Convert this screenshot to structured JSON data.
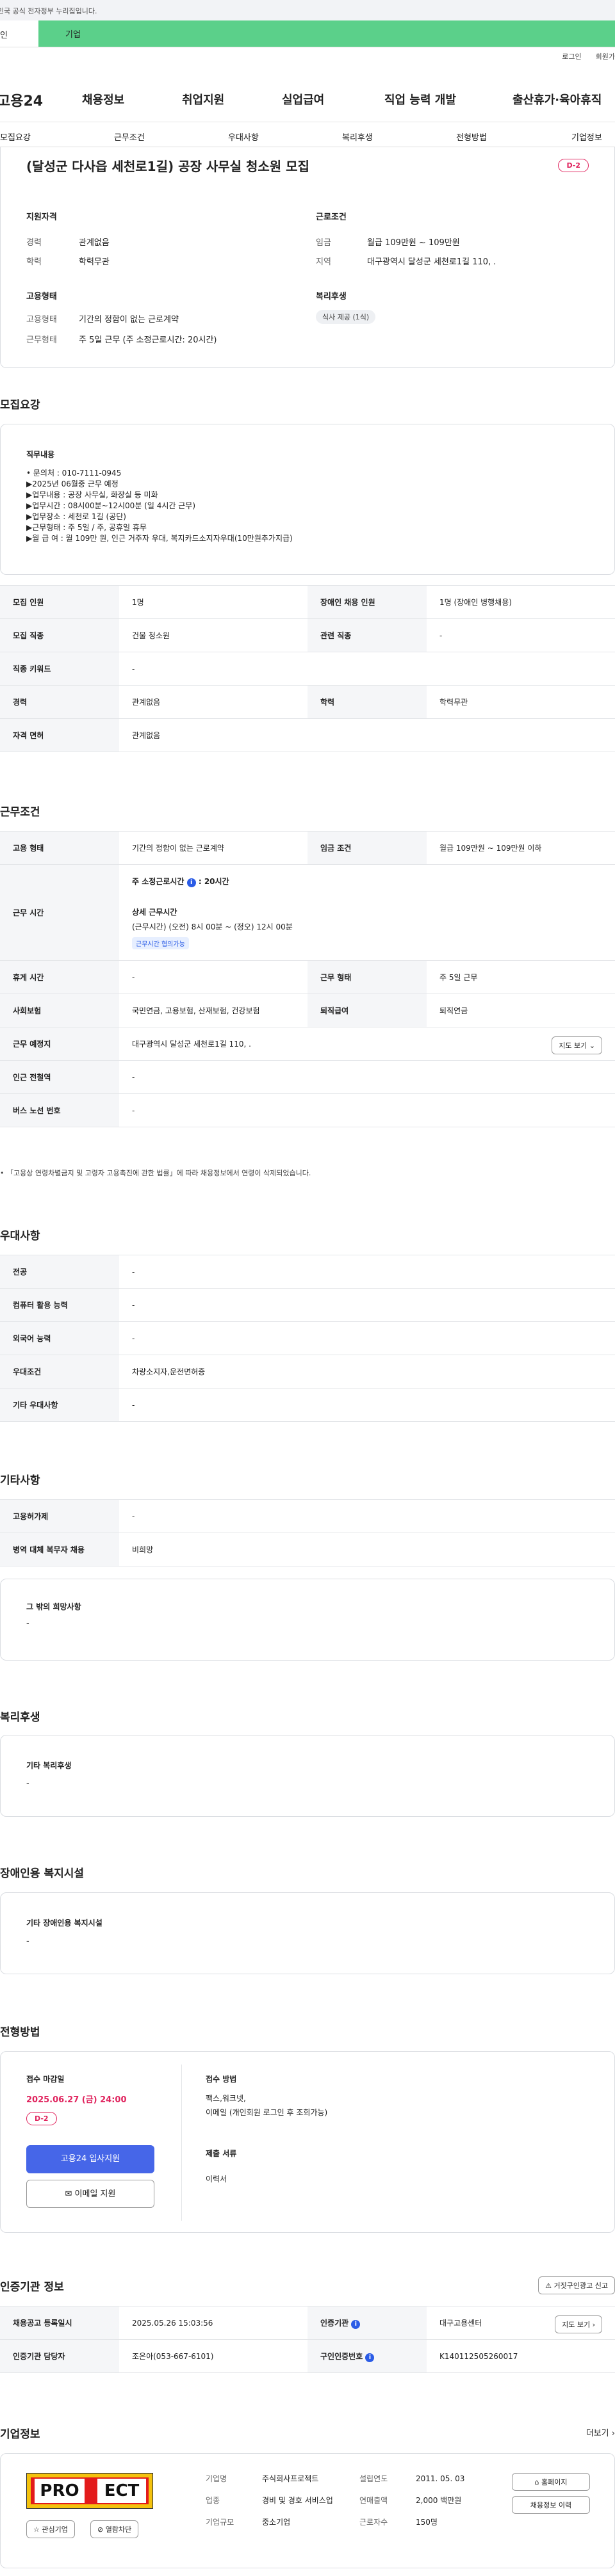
{
  "gov_banner": {
    "text": "리입",
    "highlight": "니다.",
    "full": "이 누리집은 대한민국 공식 전자정부 누리집입니다."
  },
  "topbar": {
    "left_tab": "인",
    "active_tab": "기업"
  },
  "util": {
    "login": "로그인",
    "join": "회원가"
  },
  "gnb": {
    "logo": "고용24",
    "menus": [
      "채용정보",
      "취업지원",
      "실업급여",
      "직업 능력 개발",
      "출산휴가·육아휴직"
    ]
  },
  "subnav": [
    "모집요강",
    "근무조건",
    "우대사항",
    "복리후생",
    "전형방법",
    "기업정보"
  ],
  "summary": {
    "title": "(달성군 다사읍 세천로1길) 공장 사무실 청소원 모집",
    "dday": "D-2",
    "qual_heading": "지원자격",
    "career_label": "경력",
    "career_value": "관계없음",
    "edu_label": "학력",
    "edu_value": "학력무관",
    "cond_heading": "근로조건",
    "wage_label": "임금",
    "wage_value": "월급 109만원 ~ 109만원",
    "region_label": "지역",
    "region_value": "대구광역시 달성군 세천로1길 110, .",
    "emp_heading": "고용형태",
    "emptype_label": "고용형태",
    "emptype_value": "기간의 정함이 없는 근로계약",
    "worktype_label": "근무형태",
    "worktype_value": "주 5일 근무 (주 소정근로시간: 20시간)",
    "welfare_heading": "복리후생",
    "welfare_chip": "식사 제공 (1식)"
  },
  "recruit": {
    "heading": "모집요강",
    "duty_label": "직무내용",
    "duty_lines": [
      "• 문의처 : 010-7111-0945",
      "▶2025년 06월중 근무 예정",
      "▶업무내용 : 공장 사무실, 화장실 등 미화",
      "▶업무시간 : 08시00분~12시00분 (일 4시간 근무)",
      "▶업무장소 : 세천로 1길 (공단)",
      "▶근무형태 : 주 5일 / 주, 공휴일 휴무",
      "▶월 급 여 : 월 109만 원, 인근 거주자 우대, 복지카드소지자우대(10만원추가지급)"
    ],
    "rows": [
      {
        "k1": "모집 인원",
        "v1": "1명",
        "k2": "장애인 채용 인원",
        "v2": "1명 (장애인 병행채용)"
      },
      {
        "k1": "모집 직종",
        "v1": "건물 청소원",
        "k2": "관련 직종",
        "v2": "-"
      },
      {
        "k1": "직종 키워드",
        "v1": "-"
      },
      {
        "k1": "경력",
        "v1": "관계없음",
        "k2": "학력",
        "v2": "학력무관"
      },
      {
        "k1": "자격 면허",
        "v1": "관계없음"
      }
    ]
  },
  "work": {
    "heading": "근무조건",
    "emptype_k": "고용 형태",
    "emptype_v": "기간의 정함이 없는 근로계약",
    "wage_k": "임금 조건",
    "wage_v": "월급 109만원 ~ 109만원 이하",
    "hours_k": "근무 시간",
    "hours_main": "주 소정근로시간",
    "hours_main_val": ": 20시간",
    "hours_detail_title": "상세 근무시간",
    "hours_detail": "(근무시간) (오전) 8시 00분 ~ (정오) 12시 00분",
    "hours_chip": "근무시간 협의가능",
    "rest_k": "휴게 시간",
    "rest_v": "-",
    "form_k": "근무 형태",
    "form_v": "주 5일 근무",
    "ins_k": "사회보험",
    "ins_v": "국민연금, 고용보험, 산재보험, 건강보험",
    "retire_k": "퇴직급여",
    "retire_v": "퇴직연금",
    "place_k": "근무 예정지",
    "place_v": "대구광역시 달성군 세천로1길 110, .",
    "map_btn": "지도 보기",
    "station_k": "인근 전철역",
    "station_v": "-",
    "bus_k": "버스 노선 번호",
    "bus_v": "-",
    "note": "「고용상 연령차별금지 및 고령자 고용촉진에 관한 법률」에 따라 채용정보에서 연령이 삭제되었습니다."
  },
  "pref": {
    "heading": "우대사항",
    "rows": [
      {
        "k": "전공",
        "v": "-"
      },
      {
        "k": "컴퓨터 활용 능력",
        "v": "-"
      },
      {
        "k": "외국어 능력",
        "v": "-"
      },
      {
        "k": "우대조건",
        "v": "차량소지자,운전면허증"
      },
      {
        "k": "기타 우대사항",
        "v": "-"
      }
    ]
  },
  "etc": {
    "heading": "기타사항",
    "rows": [
      {
        "k": "고용허가제",
        "v": "-"
      },
      {
        "k": "병역 대체 복무자 채용",
        "v": "비희망"
      }
    ],
    "other_label": "그 밖의 희망사항",
    "other_value": "-"
  },
  "welfare": {
    "heading": "복리후생",
    "label": "기타 복리후생",
    "value": "-"
  },
  "facility": {
    "heading": "장애인용 복지시설",
    "label": "기타 장애인용 복지시설",
    "value": "-"
  },
  "process": {
    "heading": "전형방법",
    "deadline_label": "접수 마감일",
    "deadline_value": "2025.06.27 (금) 24:00",
    "dday": "D-2",
    "apply_btn": "고용24 입사지원",
    "email_btn": "이메일 지원",
    "method_label": "접수 방법",
    "method_value1": "팩스,워크넷,",
    "method_value2": "이메일 (개인회원 로그인 후 조회가능)",
    "docs_label": "제출 서류",
    "docs_value": "이력서"
  },
  "agency": {
    "heading": "인증기관 정보",
    "report_btn": "거짓구인광고 신고",
    "reg_k": "채용공고 등록일시",
    "reg_v": "2025.05.26 15:03:56",
    "org_k": "인증기관",
    "org_v": "대구고용센터",
    "map_btn": "지도 보기",
    "mgr_k": "인증기관 담당자",
    "mgr_v": "조은아(053-667-6101)",
    "num_k": "구인인증번호",
    "num_v": "K140112505260017"
  },
  "company": {
    "heading": "기업정보",
    "more": "더보기",
    "logo_text": "PRO",
    "logo_text2": "ECT",
    "fav_btn": "관심기업",
    "block_btn": "열람차단",
    "name_k": "기업명",
    "name_v": "주식회사프로젝트",
    "ind_k": "업종",
    "ind_v": "경비 및 경호 서비스업",
    "size_k": "기업규모",
    "size_v": "중소기업",
    "est_k": "설립연도",
    "est_v": "2011. 05. 03",
    "sales_k": "연매출액",
    "sales_v": "2,000 백만원",
    "emp_k": "근로자수",
    "emp_v": "150명",
    "home_btn": "홈페이지",
    "info_btn": "채용정보 이력"
  }
}
